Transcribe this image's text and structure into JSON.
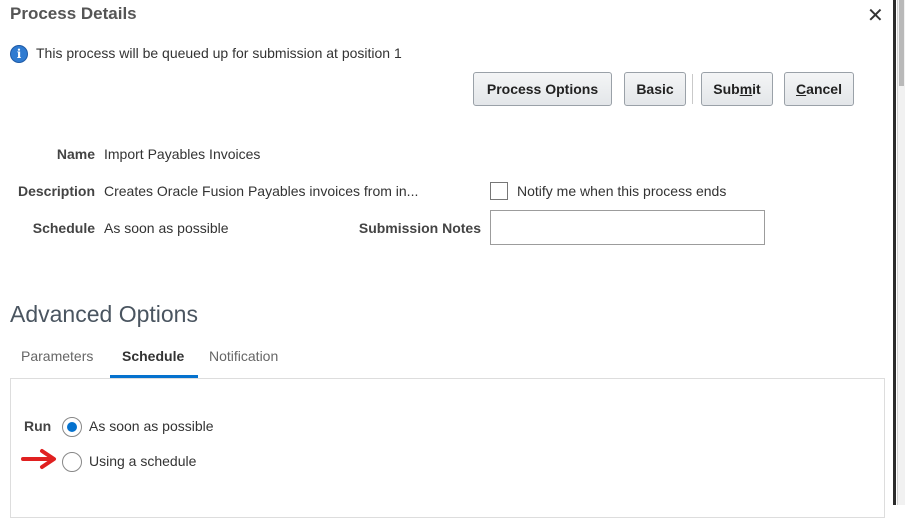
{
  "dialog": {
    "title": "Process Details",
    "close_glyph": "✕"
  },
  "info": {
    "icon": "info-icon",
    "icon_glyph": "i",
    "message": "This process will be queued up for submission at position 1"
  },
  "buttons": {
    "process_options": "Process Options",
    "basic": "Basic",
    "submit_pre": "Sub",
    "submit_key": "m",
    "submit_post": "it",
    "cancel_key": "C",
    "cancel_post": "ancel"
  },
  "details": {
    "name_label": "Name",
    "name_value": "Import Payables Invoices",
    "description_label": "Description",
    "description_value": "Creates Oracle Fusion Payables invoices from in...",
    "schedule_label": "Schedule",
    "schedule_value": "As soon as possible",
    "notify_label": "Notify me when this process ends",
    "notify_checked": false,
    "submission_notes_label": "Submission Notes",
    "submission_notes_value": ""
  },
  "advanced": {
    "title": "Advanced Options",
    "tabs": [
      {
        "label": "Parameters",
        "active": false
      },
      {
        "label": "Schedule",
        "active": true
      },
      {
        "label": "Notification",
        "active": false
      }
    ],
    "run_label": "Run",
    "run_options": [
      {
        "label": "As soon as possible",
        "selected": true
      },
      {
        "label": "Using a schedule",
        "selected": false
      }
    ]
  },
  "colors": {
    "accent": "#0572ce",
    "annotation_arrow": "#e02020"
  }
}
